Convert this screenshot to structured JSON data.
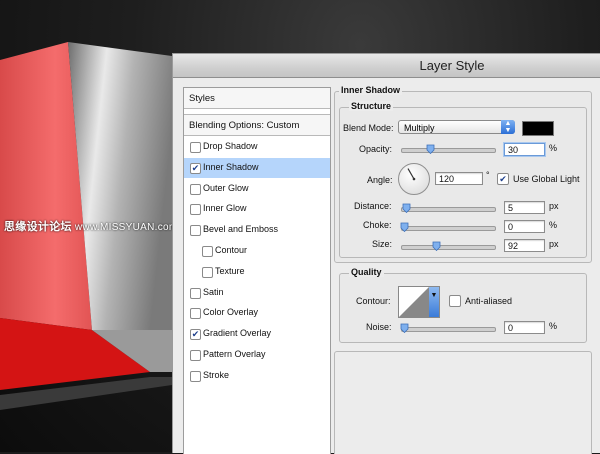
{
  "watermark": {
    "cn": "思缘设计论坛",
    "url": "www.MISSYUAN.com"
  },
  "window": {
    "title": "Layer Style"
  },
  "sidebar": {
    "styles_label": "Styles",
    "blending_label": "Blending Options: Custom",
    "items": [
      {
        "label": "Drop Shadow",
        "checked": false,
        "active": false
      },
      {
        "label": "Inner Shadow",
        "checked": true,
        "active": true
      },
      {
        "label": "Outer Glow",
        "checked": false,
        "active": false
      },
      {
        "label": "Inner Glow",
        "checked": false,
        "active": false
      },
      {
        "label": "Bevel and Emboss",
        "checked": false,
        "active": false
      },
      {
        "label": "Contour",
        "checked": false,
        "active": false,
        "indent": true
      },
      {
        "label": "Texture",
        "checked": false,
        "active": false,
        "indent": true
      },
      {
        "label": "Satin",
        "checked": false,
        "active": false
      },
      {
        "label": "Color Overlay",
        "checked": false,
        "active": false
      },
      {
        "label": "Gradient Overlay",
        "checked": true,
        "active": false
      },
      {
        "label": "Pattern Overlay",
        "checked": false,
        "active": false
      },
      {
        "label": "Stroke",
        "checked": false,
        "active": false
      }
    ]
  },
  "inner_shadow": {
    "section_title": "Inner Shadow",
    "structure_title": "Structure",
    "blend_mode_label": "Blend Mode:",
    "blend_mode_value": "Multiply",
    "shadow_color": "#000000",
    "opacity_label": "Opacity:",
    "opacity_value": "30",
    "opacity_unit": "%",
    "opacity_level": 0.3,
    "angle_label": "Angle:",
    "angle_value": "120",
    "angle_unit": "°",
    "use_global_light_label": "Use Global Light",
    "use_global_light": true,
    "distance_label": "Distance:",
    "distance_value": "5",
    "distance_unit": "px",
    "distance_level": 0.02,
    "choke_label": "Choke:",
    "choke_value": "0",
    "choke_unit": "%",
    "choke_level": 0.0,
    "size_label": "Size:",
    "size_value": "92",
    "size_unit": "px",
    "size_level": 0.37,
    "quality_title": "Quality",
    "contour_label": "Contour:",
    "anti_aliased_label": "Anti-aliased",
    "anti_aliased": false,
    "noise_label": "Noise:",
    "noise_value": "0",
    "noise_unit": "%",
    "noise_level": 0.0
  },
  "colors": {
    "cube_red": "#f06060",
    "cube_dark_red": "#d41414",
    "selection": "#b5d5fb",
    "accent_blue": "#2b6fd6"
  }
}
